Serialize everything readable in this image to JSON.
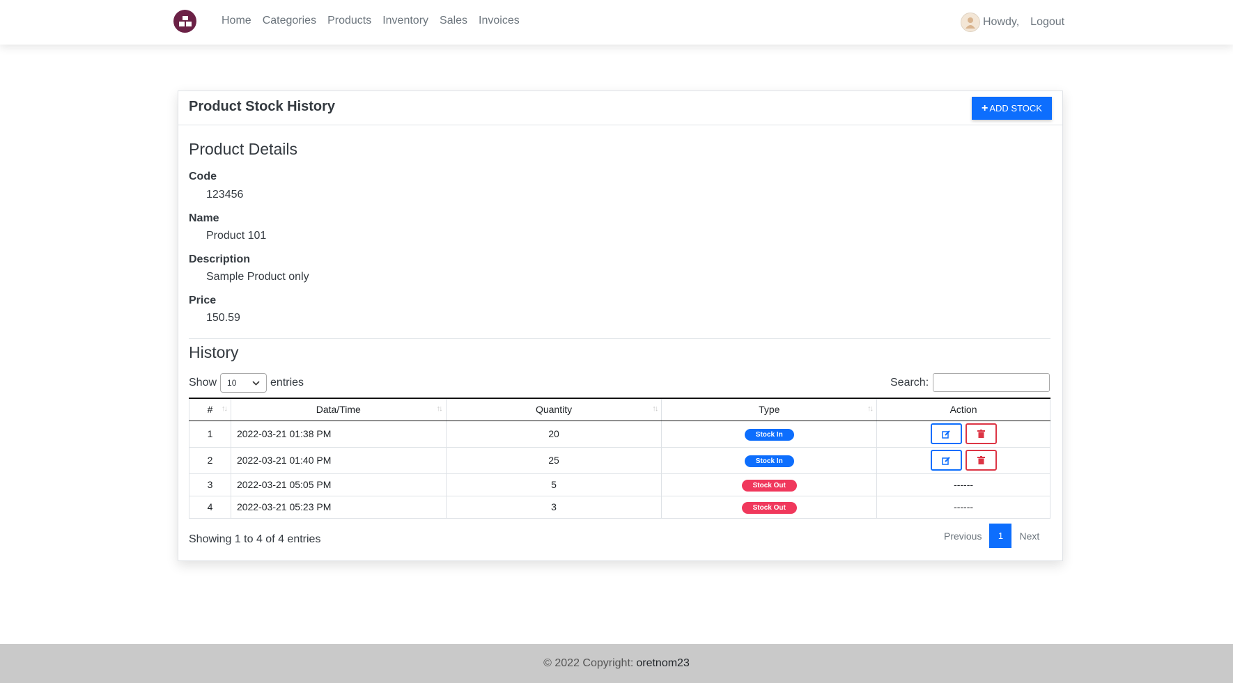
{
  "nav": {
    "links": [
      "Home",
      "Categories",
      "Products",
      "Inventory",
      "Sales",
      "Invoices"
    ],
    "howdy": "Howdy,",
    "logout": "Logout"
  },
  "card": {
    "title": "Product Stock History",
    "add_button": "ADD STOCK"
  },
  "details": {
    "heading": "Product Details",
    "code_label": "Code",
    "code_value": "123456",
    "name_label": "Name",
    "name_value": "Product 101",
    "description_label": "Description",
    "description_value": "Sample Product only",
    "price_label": "Price",
    "price_value": "150.59"
  },
  "history": {
    "heading": "History",
    "show_label": "Show",
    "entries_label": "entries",
    "page_size": "10",
    "search_label": "Search:",
    "columns": [
      "#",
      "Data/Time",
      "Quantity",
      "Type",
      "Action"
    ],
    "rows": [
      {
        "num": "1",
        "datetime": "2022-03-21 01:38 PM",
        "quantity": "20",
        "type": "Stock In",
        "action": "buttons"
      },
      {
        "num": "2",
        "datetime": "2022-03-21 01:40 PM",
        "quantity": "25",
        "type": "Stock In",
        "action": "buttons"
      },
      {
        "num": "3",
        "datetime": "2022-03-21 05:05 PM",
        "quantity": "5",
        "type": "Stock Out",
        "action": "------"
      },
      {
        "num": "4",
        "datetime": "2022-03-21 05:23 PM",
        "quantity": "3",
        "type": "Stock Out",
        "action": "------"
      }
    ],
    "info": "Showing 1 to 4 of 4 entries",
    "previous": "Previous",
    "current_page": "1",
    "next": "Next"
  },
  "footer": {
    "copyright": "© 2022 Copyright:",
    "owner": "oretnom23"
  },
  "colors": {
    "primary": "#0d6efd",
    "danger": "#f0385c",
    "logo": "#6b2146",
    "footer_bg": "#c9c9c9"
  }
}
